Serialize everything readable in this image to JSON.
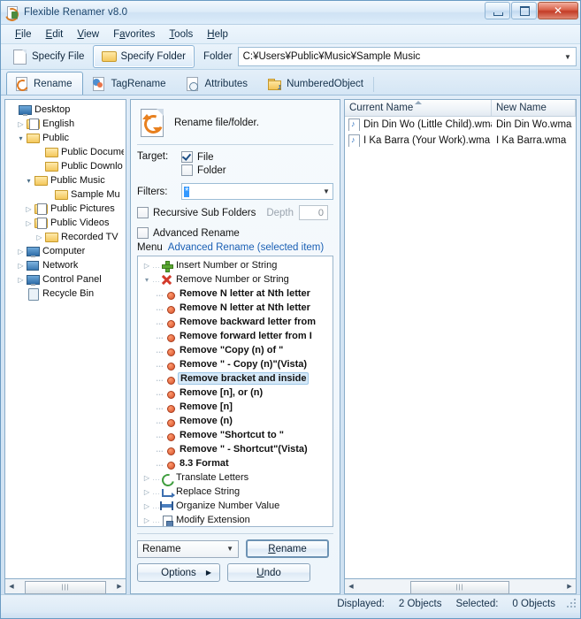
{
  "window": {
    "title": "Flexible Renamer v8.0",
    "app_icon": "renamer-app-icon",
    "minimize": "minimize-icon",
    "maximize": "maximize-icon",
    "close": "✕"
  },
  "menubar": {
    "items": [
      {
        "label": "File",
        "accel": "F"
      },
      {
        "label": "Edit",
        "accel": "E"
      },
      {
        "label": "View",
        "accel": "V"
      },
      {
        "label": "Favorites",
        "accel": "a"
      },
      {
        "label": "Tools",
        "accel": "T"
      },
      {
        "label": "Help",
        "accel": "H"
      }
    ]
  },
  "toolbar": {
    "specify_file": "Specify File",
    "specify_folder": "Specify Folder",
    "folder_label": "Folder",
    "folder_path": "C:¥Users¥Public¥Music¥Sample Music",
    "folder_dropdown_icon": "chevron-down-icon"
  },
  "tabs": [
    {
      "label": "Rename",
      "icon": "rename-icon",
      "selected": true
    },
    {
      "label": "TagRename",
      "icon": "tagrename-icon",
      "selected": false
    },
    {
      "label": "Attributes",
      "icon": "attributes-icon",
      "selected": false
    },
    {
      "label": "NumberedObject",
      "icon": "numberedobject-icon",
      "selected": false
    }
  ],
  "folder_tree": {
    "items": [
      {
        "label": "Desktop",
        "indent": 0,
        "expander": "none",
        "icon": "desktop-icon"
      },
      {
        "label": "English",
        "indent": 1,
        "expander": "collapsed",
        "icon": "folder-special-icon"
      },
      {
        "label": "Public",
        "indent": 1,
        "expander": "expanded",
        "icon": "folder-icon"
      },
      {
        "label": "Public Docume",
        "indent": 2,
        "expander": "none",
        "icon": "folder-docs-icon"
      },
      {
        "label": "Public Downlo",
        "indent": 2,
        "expander": "none",
        "icon": "folder-icon"
      },
      {
        "label": "Public Music",
        "indent": 2,
        "expander": "expanded",
        "icon": "folder-music-icon"
      },
      {
        "label": "Sample Mu",
        "indent": 3,
        "expander": "none",
        "icon": "folder-icon",
        "selected": true
      },
      {
        "label": "Public Pictures",
        "indent": 2,
        "expander": "collapsed",
        "icon": "folder-pictures-icon"
      },
      {
        "label": "Public Videos",
        "indent": 2,
        "expander": "collapsed",
        "icon": "folder-videos-icon"
      },
      {
        "label": "Recorded TV",
        "indent": 2,
        "expander": "collapsed",
        "icon": "folder-icon"
      },
      {
        "label": "Computer",
        "indent": 1,
        "expander": "collapsed",
        "icon": "computer-icon"
      },
      {
        "label": "Network",
        "indent": 1,
        "expander": "collapsed",
        "icon": "network-icon"
      },
      {
        "label": "Control Panel",
        "indent": 1,
        "expander": "collapsed",
        "icon": "control-panel-icon"
      },
      {
        "label": "Recycle Bin",
        "indent": 1,
        "expander": "none",
        "icon": "recycle-bin-icon"
      }
    ]
  },
  "rename_panel": {
    "heading": "Rename file/folder.",
    "heading_icon": "rename-large-icon",
    "target_label": "Target:",
    "target_file": {
      "label": "File",
      "checked": true
    },
    "target_folder": {
      "label": "Folder",
      "checked": false
    },
    "filters_label": "Filters:",
    "filters_value": "*",
    "filters_dropdown_icon": "chevron-down-icon",
    "recursive": {
      "label": "Recursive Sub Folders",
      "checked": false
    },
    "depth_label": "Depth",
    "depth_value": "0",
    "advanced": {
      "label": "Advanced Rename",
      "checked": false
    },
    "menu_label": "Menu",
    "menu_link": "Advanced Rename (selected item)"
  },
  "method_tree": [
    {
      "label": "Insert Number or String",
      "level": 1,
      "expander": "collapsed",
      "icon": "plus-icon",
      "bold": false,
      "selected": false
    },
    {
      "label": "Remove Number or String",
      "level": 1,
      "expander": "expanded",
      "icon": "x-icon",
      "bold": false,
      "selected": false
    },
    {
      "label": "Remove N letter at Nth letter",
      "level": 2,
      "expander": "leaf",
      "icon": "bullet-icon",
      "bold": true,
      "selected": false
    },
    {
      "label": "Remove N letter at Nth letter",
      "level": 2,
      "expander": "leaf",
      "icon": "bullet-icon",
      "bold": true,
      "selected": false
    },
    {
      "label": "Remove backward letter from",
      "level": 2,
      "expander": "leaf",
      "icon": "bullet-icon",
      "bold": true,
      "selected": false
    },
    {
      "label": "Remove forward letter from I",
      "level": 2,
      "expander": "leaf",
      "icon": "bullet-icon",
      "bold": true,
      "selected": false
    },
    {
      "label": "Remove \"Copy (n) of \"",
      "level": 2,
      "expander": "leaf",
      "icon": "bullet-icon",
      "bold": true,
      "selected": false
    },
    {
      "label": "Remove \" - Copy (n)\"(Vista)",
      "level": 2,
      "expander": "leaf",
      "icon": "bullet-icon",
      "bold": true,
      "selected": false
    },
    {
      "label": "Remove bracket and inside",
      "level": 2,
      "expander": "leaf",
      "icon": "bullet-icon",
      "bold": true,
      "selected": true
    },
    {
      "label": "Remove [n], or (n)",
      "level": 2,
      "expander": "leaf",
      "icon": "bullet-icon",
      "bold": true,
      "selected": false
    },
    {
      "label": "Remove [n]",
      "level": 2,
      "expander": "leaf",
      "icon": "bullet-icon",
      "bold": true,
      "selected": false
    },
    {
      "label": "Remove (n)",
      "level": 2,
      "expander": "leaf",
      "icon": "bullet-icon",
      "bold": true,
      "selected": false
    },
    {
      "label": "Remove \"Shortcut to \"",
      "level": 2,
      "expander": "leaf",
      "icon": "bullet-icon",
      "bold": true,
      "selected": false
    },
    {
      "label": "Remove \" - Shortcut\"(Vista)",
      "level": 2,
      "expander": "leaf",
      "icon": "bullet-icon",
      "bold": true,
      "selected": false
    },
    {
      "label": "8.3 Format",
      "level": 2,
      "expander": "leaf",
      "icon": "bullet-icon",
      "bold": true,
      "selected": false
    },
    {
      "label": "Translate Letters",
      "level": 1,
      "expander": "collapsed",
      "icon": "translate-icon",
      "bold": false,
      "selected": false
    },
    {
      "label": "Replace String",
      "level": 1,
      "expander": "collapsed",
      "icon": "replace-icon",
      "bold": false,
      "selected": false
    },
    {
      "label": "Organize Number Value",
      "level": 1,
      "expander": "collapsed",
      "icon": "organize-icon",
      "bold": false,
      "selected": false
    },
    {
      "label": "Modify Extension",
      "level": 1,
      "expander": "collapsed",
      "icon": "extension-icon",
      "bold": false,
      "selected": false
    }
  ],
  "actions": {
    "mode_value": "Rename",
    "mode_dropdown_icon": "chevron-down-icon",
    "rename_button": "Rename",
    "options_button": "Options",
    "options_arrow_icon": "chevron-right-icon",
    "undo_button": "Undo"
  },
  "file_list": {
    "columns": [
      {
        "label": "Current Name",
        "sorted": true,
        "sort_icon": "sort-ascending-icon"
      },
      {
        "label": "New Name",
        "sorted": false
      }
    ],
    "rows": [
      {
        "icon": "wma-audio-icon",
        "current": "Din Din Wo (Little Child).wma",
        "new": "Din Din Wo.wma"
      },
      {
        "icon": "wma-audio-icon",
        "current": "I Ka Barra (Your Work).wma",
        "new": "I Ka Barra.wma"
      }
    ]
  },
  "status": {
    "displayed_label": "Displayed:",
    "displayed_value": "2 Objects",
    "selected_label": "Selected:",
    "selected_value": "0 Objects"
  },
  "colors": {
    "accent": "#1a5fb4",
    "selection": "#d6e9f8",
    "highlight": "#3399ff",
    "close_button": "#c33c26"
  }
}
